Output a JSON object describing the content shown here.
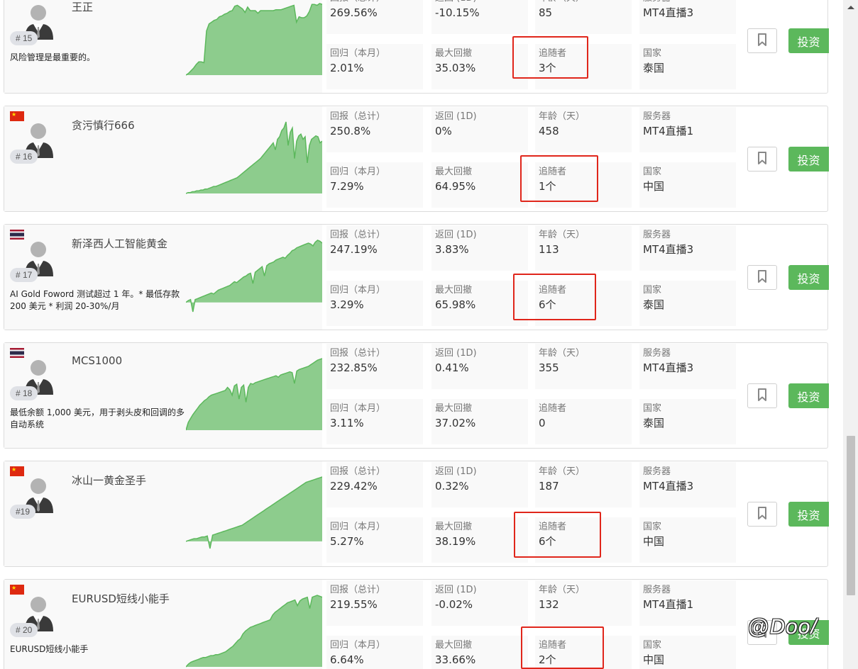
{
  "stat_labels": {
    "total_return": "回报（总计）",
    "return_1d": "返回 (1D)",
    "age": "年龄（天）",
    "server": "服务器",
    "monthly_return": "回归（本月）",
    "max_drawdown": "最大回撤",
    "followers": "追随者",
    "country": "国家"
  },
  "invest_label": "投资",
  "watermark": "@Doo/",
  "colors": {
    "accent_green": "#5cb85c",
    "chart_fill": "#8dcc8d",
    "chart_line": "#5cb85c",
    "highlight_red": "#e0261b"
  },
  "icons": {
    "bookmark": "bookmark-icon",
    "avatar": "user-avatar-icon"
  },
  "strategies": [
    {
      "rank": "# 15",
      "name": "王正",
      "flag": "none",
      "description": "风险管理是最重要的。",
      "total_return": "269.56%",
      "return_1d": "-10.15%",
      "age": "85",
      "server": "MT4直播3",
      "monthly_return": "2.01%",
      "max_drawdown": "35.03%",
      "followers": "3个",
      "country": "泰国",
      "highlight_followers": true,
      "equity_curve": [
        0,
        2,
        5,
        8,
        12,
        15,
        15,
        14,
        50,
        58,
        60,
        62,
        63,
        66,
        67,
        69,
        70,
        72,
        73,
        78,
        79,
        77,
        75,
        71,
        77,
        73,
        73,
        73,
        70,
        73,
        73,
        73,
        73,
        73,
        73,
        74,
        74,
        74,
        75,
        76,
        77,
        78,
        79,
        60,
        66,
        65,
        65,
        67,
        72,
        80,
        80,
        79,
        81,
        80
      ]
    },
    {
      "rank": "# 16",
      "name": "贪污慎行666",
      "flag": "cn",
      "description": "",
      "total_return": "250.8%",
      "return_1d": "0%",
      "age": "458",
      "server": "MT4直播1",
      "monthly_return": "7.29%",
      "max_drawdown": "64.95%",
      "followers": "1个",
      "country": "中国",
      "highlight_followers": true,
      "equity_curve": [
        0,
        1,
        1,
        2,
        2,
        3,
        3,
        4,
        4,
        5,
        5,
        6,
        7,
        8,
        8,
        9,
        10,
        11,
        12,
        13,
        14,
        15,
        16,
        17,
        18,
        20,
        22,
        24,
        26,
        28,
        30,
        32,
        34,
        36,
        38,
        40,
        43,
        46,
        49,
        52,
        55,
        58,
        50,
        62,
        65,
        72,
        75,
        82,
        55,
        70,
        75,
        40,
        60,
        66,
        68,
        62,
        65,
        35,
        55,
        62,
        64,
        66,
        65,
        58,
        60
      ]
    },
    {
      "rank": "# 17",
      "name": "新泽西人工智能黄金",
      "flag": "th",
      "description": "AI Gold Foword 测试超过 1 年。* 最低存款 200 美元 * 利润 20-30%/月",
      "total_return": "247.19%",
      "return_1d": "3.83%",
      "age": "113",
      "server": "MT4直播3",
      "monthly_return": "3.29%",
      "max_drawdown": "65.98%",
      "followers": "6个",
      "country": "泰国",
      "highlight_followers": true,
      "equity_curve": [
        0,
        2,
        3,
        -10,
        3,
        4,
        5,
        6,
        7,
        8,
        9,
        10,
        9,
        11,
        13,
        14,
        15,
        16,
        17,
        18,
        20,
        22,
        21,
        23,
        25,
        27,
        28,
        30,
        31,
        20,
        32,
        34,
        36,
        38,
        28,
        39,
        41,
        42,
        43,
        45,
        46,
        47,
        48,
        47,
        50,
        52,
        55,
        56,
        58,
        59,
        60,
        61,
        62,
        63,
        62,
        60,
        64,
        66,
        65,
        63
      ]
    },
    {
      "rank": "# 18",
      "name": "MCS1000",
      "flag": "th",
      "description": "最低余额 1,000 美元，用于剥头皮和回调的多自动系统",
      "total_return": "232.85%",
      "return_1d": "0.41%",
      "age": "355",
      "server": "MT4直播3",
      "monthly_return": "3.11%",
      "max_drawdown": "37.02%",
      "followers": "0",
      "country": "泰国",
      "highlight_followers": false,
      "equity_curve": [
        0,
        10,
        15,
        20,
        24,
        28,
        32,
        35,
        38,
        40,
        43,
        45,
        46,
        47,
        48,
        49,
        50,
        51,
        55,
        52,
        45,
        57,
        59,
        40,
        55,
        58,
        36,
        55,
        60,
        59,
        61,
        62,
        63,
        64,
        65,
        66,
        67,
        68,
        69,
        70,
        68,
        71,
        72,
        73,
        74,
        75,
        74,
        60,
        76,
        78,
        79,
        80,
        81,
        82,
        84,
        86,
        88,
        90,
        91,
        92
      ]
    },
    {
      "rank": "#19",
      "name": "冰山一黄金圣手",
      "flag": "cn",
      "description": "",
      "total_return": "229.42%",
      "return_1d": "0.32%",
      "age": "187",
      "server": "MT4直播3",
      "monthly_return": "5.27%",
      "max_drawdown": "38.19%",
      "followers": "6个",
      "country": "中国",
      "highlight_followers": true,
      "equity_curve": [
        0,
        1,
        2,
        3,
        3,
        4,
        5,
        5,
        6,
        -8,
        7,
        8,
        9,
        10,
        11,
        12,
        13,
        14,
        15,
        16,
        17,
        18,
        20,
        22,
        24,
        26,
        28,
        30,
        32,
        34,
        36,
        38,
        40,
        42,
        44,
        46,
        48,
        50,
        52,
        54,
        56,
        58,
        60,
        62,
        64,
        66,
        67,
        68,
        69,
        70,
        71,
        72
      ]
    },
    {
      "rank": "# 20",
      "name": "EURUSD短线小能手",
      "flag": "cn",
      "description": "EURUSD短线小能手",
      "total_return": "219.55%",
      "return_1d": "-0.02%",
      "age": "132",
      "server": "MT4直播1",
      "monthly_return": "6.64%",
      "max_drawdown": "33.66%",
      "followers": "2个",
      "country": "中国",
      "highlight_followers": true,
      "equity_curve": [
        0,
        3,
        5,
        6,
        7,
        8,
        9,
        10,
        10,
        11,
        12,
        12,
        13,
        13,
        14,
        15,
        16,
        18,
        20,
        22,
        25,
        28,
        30,
        35,
        38,
        40,
        42,
        43,
        44,
        45,
        46,
        47,
        48,
        49,
        50,
        55,
        58,
        60,
        62,
        64,
        66,
        68,
        69,
        70,
        71,
        65,
        70,
        72,
        73,
        74,
        62,
        74,
        75,
        76,
        75,
        74
      ]
    }
  ]
}
